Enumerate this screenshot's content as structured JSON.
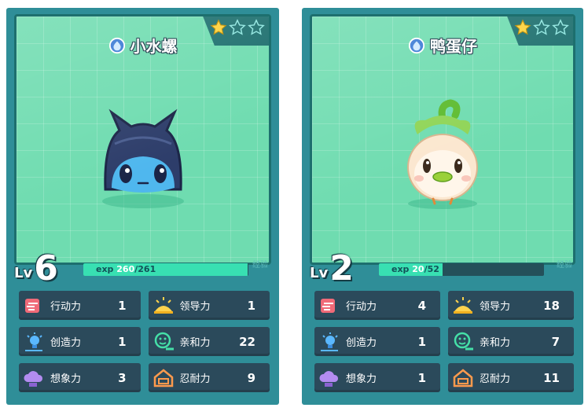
{
  "cards": [
    {
      "name": "小水螺",
      "stars_filled": 1,
      "stars_total": 3,
      "level_label": "Lv",
      "level": "6",
      "exp_label": "exp",
      "exp_current": "260",
      "exp_sep_max": "/261",
      "exp_fraction": 0.996,
      "exp_side_label": "经验",
      "stats": [
        {
          "label": "行动力",
          "value": "1",
          "icon": "running-icon",
          "color": "#f06a78"
        },
        {
          "label": "领导力",
          "value": "1",
          "icon": "sunrise-icon",
          "color": "#ffd34d"
        },
        {
          "label": "创造力",
          "value": "1",
          "icon": "lightbulb-icon",
          "color": "#5ab8ff"
        },
        {
          "label": "亲和力",
          "value": "22",
          "icon": "smile-icon",
          "color": "#45e0a8"
        },
        {
          "label": "想象力",
          "value": "3",
          "icon": "cloud-icon",
          "color": "#b38cf0"
        },
        {
          "label": "忍耐力",
          "value": "9",
          "icon": "house-icon",
          "color": "#ff9a4d"
        }
      ]
    },
    {
      "name": "鸭蛋仔",
      "stars_filled": 1,
      "stars_total": 3,
      "level_label": "Lv",
      "level": "2",
      "exp_label": "exp",
      "exp_current": "20",
      "exp_sep_max": "/52",
      "exp_fraction": 0.385,
      "exp_side_label": "经验",
      "stats": [
        {
          "label": "行动力",
          "value": "4",
          "icon": "running-icon",
          "color": "#f06a78"
        },
        {
          "label": "领导力",
          "value": "18",
          "icon": "sunrise-icon",
          "color": "#ffd34d"
        },
        {
          "label": "创造力",
          "value": "1",
          "icon": "lightbulb-icon",
          "color": "#5ab8ff"
        },
        {
          "label": "亲和力",
          "value": "7",
          "icon": "smile-icon",
          "color": "#45e0a8"
        },
        {
          "label": "想象力",
          "value": "1",
          "icon": "cloud-icon",
          "color": "#b38cf0"
        },
        {
          "label": "忍耐力",
          "value": "11",
          "icon": "house-icon",
          "color": "#ff9a4d"
        }
      ]
    }
  ]
}
